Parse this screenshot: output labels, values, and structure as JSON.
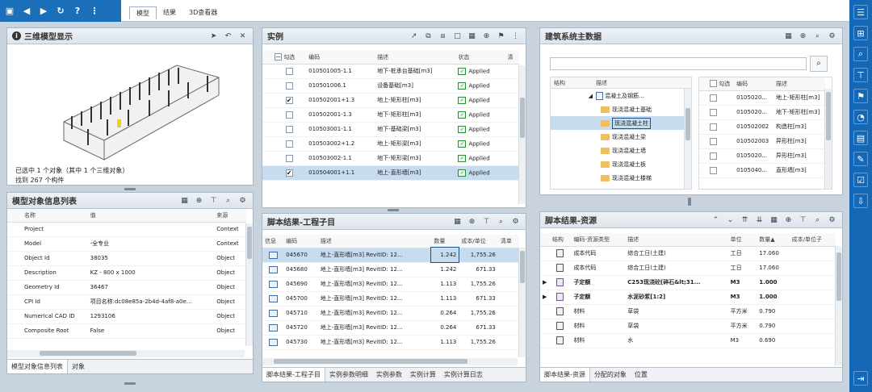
{
  "topbar": {
    "tabs": [
      "模型",
      "结果",
      "3D查看器"
    ],
    "menu_dots": "⋮"
  },
  "viewer": {
    "title": "三维模型显示",
    "status_line1": "已选中 1 个对象（其中 1 个三维对象）",
    "status_line2": "找到 267 个构件"
  },
  "props": {
    "title": "模型对象信息列表",
    "headers": [
      "名称",
      "值",
      "来源"
    ],
    "rows": [
      {
        "name": "Project",
        "value": "",
        "source": "Context"
      },
      {
        "name": "Model",
        "value": "-全专业",
        "source": "Context"
      },
      {
        "name": "Object Id",
        "value": "38035",
        "source": "Object"
      },
      {
        "name": "Description",
        "value": "KZ - 800 x 1000",
        "source": "Object"
      },
      {
        "name": "Geometry Id",
        "value": "36467",
        "source": "Object"
      },
      {
        "name": "CPI Id",
        "value": "项目名称:dc08e85a-2b4d-4af8-a0e...",
        "source": "Object"
      },
      {
        "name": "Numerical CAD ID",
        "value": "1293106",
        "source": "Object"
      },
      {
        "name": "Composite Root",
        "value": "False",
        "source": "Object"
      }
    ],
    "tabs": [
      "模型对象信息列表",
      "对象"
    ]
  },
  "instances": {
    "title": "实例",
    "headers": [
      "勾选",
      "编码",
      "描述",
      "状态",
      "清"
    ],
    "rows": [
      {
        "checked": false,
        "code": "010501005-1.1",
        "desc": "地下-桩承台基础[m3]",
        "status": "Applied"
      },
      {
        "checked": false,
        "code": "010501006.1",
        "desc": "设备基础[m3]",
        "status": "Applied"
      },
      {
        "checked": true,
        "code": "010502001+1.3",
        "desc": "地上-矩形柱[m3]",
        "status": "Applied"
      },
      {
        "checked": false,
        "code": "010502001-1.3",
        "desc": "地下-矩形柱[m3]",
        "status": "Applied"
      },
      {
        "checked": false,
        "code": "010503001-1.1",
        "desc": "地下-基础梁[m3]",
        "status": "Applied"
      },
      {
        "checked": false,
        "code": "010503002+1.2",
        "desc": "地上-矩形梁[m3]",
        "status": "Applied"
      },
      {
        "checked": false,
        "code": "010503002-1.1",
        "desc": "地下-矩形梁[m3]",
        "status": "Applied"
      },
      {
        "checked": true,
        "code": "010504001+1.1",
        "desc": "地上-直形墙[m3]",
        "status": "Applied",
        "selected": true
      }
    ]
  },
  "master": {
    "title": "建筑系统主数据",
    "tree_headers": [
      "结构",
      "描述"
    ],
    "tree_root": "混凝土及钢筋...",
    "tree_items": [
      "现浇混凝土基础",
      "现浇混凝土柱",
      "现浇混凝土梁",
      "现浇混凝土墙",
      "现浇混凝土板",
      "现浇混凝土楼梯"
    ],
    "grid_headers": [
      "勾选",
      "编码",
      "描述"
    ],
    "grid_rows": [
      {
        "code": "0105020...",
        "desc": "地上-矩形柱[m3]"
      },
      {
        "code": "0105020...",
        "desc": "地下-矩形柱[m3]"
      },
      {
        "code": "010502002",
        "desc": "构造柱[m3]"
      },
      {
        "code": "010502003",
        "desc": "异形柱[m3]"
      },
      {
        "code": "0105020...",
        "desc": "异形柱[m3]"
      },
      {
        "code": "0105040...",
        "desc": "直形墙[m3]"
      }
    ]
  },
  "script": {
    "title": "脚本结果-工程子目",
    "headers": [
      "信息",
      "编码",
      "描述",
      "数量",
      "成本/单位",
      "清单"
    ],
    "rows": [
      {
        "code": "045670",
        "desc": "地上-直形墙[m3] RevitID: 12...",
        "qty": "1.242",
        "cost": "1,755.26",
        "selected": true
      },
      {
        "code": "045680",
        "desc": "地上-直形墙[m3] RevitID: 12...",
        "qty": "1.242",
        "cost": "671.33"
      },
      {
        "code": "045690",
        "desc": "地上-直形墙[m3] RevitID: 12...",
        "qty": "1.113",
        "cost": "1,755.26"
      },
      {
        "code": "045700",
        "desc": "地上-直形墙[m3] RevitID: 12...",
        "qty": "1.113",
        "cost": "671.33"
      },
      {
        "code": "045710",
        "desc": "地上-直形墙[m3] RevitID: 12...",
        "qty": "0.264",
        "cost": "1,755.26"
      },
      {
        "code": "045720",
        "desc": "地上-直形墙[m3] RevitID: 12...",
        "qty": "0.264",
        "cost": "671.33"
      },
      {
        "code": "045730",
        "desc": "地上-直形墙[m3] RevitID: 12...",
        "qty": "1.113",
        "cost": "1,755.26"
      }
    ],
    "tabs": [
      "脚本结果-工程子目",
      "实例参数明细",
      "实例参数",
      "实例计算",
      "实例计算日志"
    ]
  },
  "resource": {
    "title": "脚本结果-资源",
    "headers": [
      "结构",
      "编码-资源类型",
      "描述",
      "单位",
      "数量▲",
      "成本/单位子"
    ],
    "rows": [
      {
        "type": "成本代码",
        "desc": "综合工日(土建)",
        "unit": "工日",
        "qty": "17.060",
        "expand": false,
        "purple": false,
        "bold": false
      },
      {
        "type": "成本代码",
        "desc": "综合工日(土建)",
        "unit": "工日",
        "qty": "17.060",
        "expand": false,
        "purple": false,
        "bold": false
      },
      {
        "type": "子定额",
        "desc": "C253现浇砼[碎石&lt;31...",
        "unit": "M3",
        "qty": "1.000",
        "expand": true,
        "purple": true,
        "bold": true
      },
      {
        "type": "子定额",
        "desc": "水泥砂浆[1:2]",
        "unit": "M3",
        "qty": "1.000",
        "expand": true,
        "purple": true,
        "bold": true
      },
      {
        "type": "材料",
        "desc": "草袋",
        "unit": "平方米",
        "qty": "0.790",
        "expand": false,
        "purple": false,
        "bold": false
      },
      {
        "type": "材料",
        "desc": "草袋",
        "unit": "平方米",
        "qty": "0.790",
        "expand": false,
        "purple": false,
        "bold": false
      },
      {
        "type": "材料",
        "desc": "水",
        "unit": "M3",
        "qty": "0.690",
        "expand": false,
        "purple": false,
        "bold": false
      }
    ],
    "tabs": [
      "脚本结果-资源",
      "分配的对象",
      "位置"
    ]
  }
}
